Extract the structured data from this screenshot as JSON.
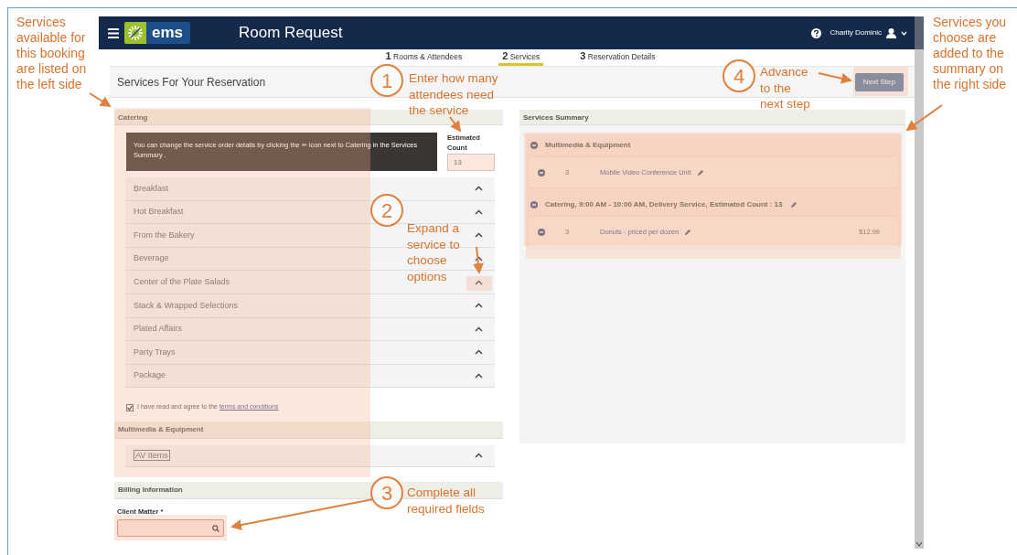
{
  "side_notes": [
    {
      "text": "Services available for this booking are listed on the left side"
    },
    {
      "text": "Services you choose are added to the summary on the right side"
    }
  ],
  "navbar": {
    "logo": "ems",
    "title": "Room Request",
    "user": "Charity Dominic"
  },
  "steps": [
    {
      "number": "1",
      "label": "Rooms & Attendees",
      "selected": false
    },
    {
      "number": "2",
      "label": "Services",
      "selected": true
    },
    {
      "number": "3",
      "label": "Reservation Details",
      "selected": false
    }
  ],
  "header": {
    "title": "Services For Your Reservation",
    "next_button": "Next Step"
  },
  "catering": {
    "title": "Catering",
    "tooltip": "You can change the service order details by clicking the ✏ icon next to Catering in the Services Summary .",
    "count_label": "Estimated Count",
    "count_value": "13",
    "items": [
      {
        "label": "Breakfast"
      },
      {
        "label": "Hot Breakfast"
      },
      {
        "label": "From the Bakery"
      },
      {
        "label": "Beverage"
      },
      {
        "label": "Center of the Plate Salads"
      },
      {
        "label": "Stack & Wrapped Selections"
      },
      {
        "label": "Plated Affairs"
      },
      {
        "label": "Party Trays"
      },
      {
        "label": "Package"
      }
    ],
    "terms": {
      "text": "I have read and agree to the",
      "link": "terms and conditions",
      "checked": true
    }
  },
  "multimedia": {
    "title": "Multimedia & Equipment",
    "items": [
      {
        "label": "AV Items"
      }
    ]
  },
  "billing": {
    "title": "Billing Information",
    "field_label": "Client Matter *"
  },
  "summary": {
    "title": "Services Summary",
    "groups": [
      {
        "title": "Multimedia & Equipment",
        "editable": false,
        "items": [
          {
            "qty": "3",
            "name": "Mobile Video Conference Unit"
          }
        ]
      },
      {
        "title": "Catering, 9:00 AM - 10:00 AM, Delivery Service, Estimated Count : 13",
        "editable": true,
        "items": [
          {
            "qty": "3",
            "name": "Donuts - priced per dozen",
            "price": "$12.99"
          }
        ]
      }
    ]
  },
  "callouts": [
    {
      "number": "1",
      "text": "Enter how many attendees need the service"
    },
    {
      "number": "2",
      "text": "Expand a service to choose options"
    },
    {
      "number": "3",
      "text": "Complete all required fields"
    },
    {
      "number": "4",
      "text": "Advance to the next step"
    }
  ]
}
